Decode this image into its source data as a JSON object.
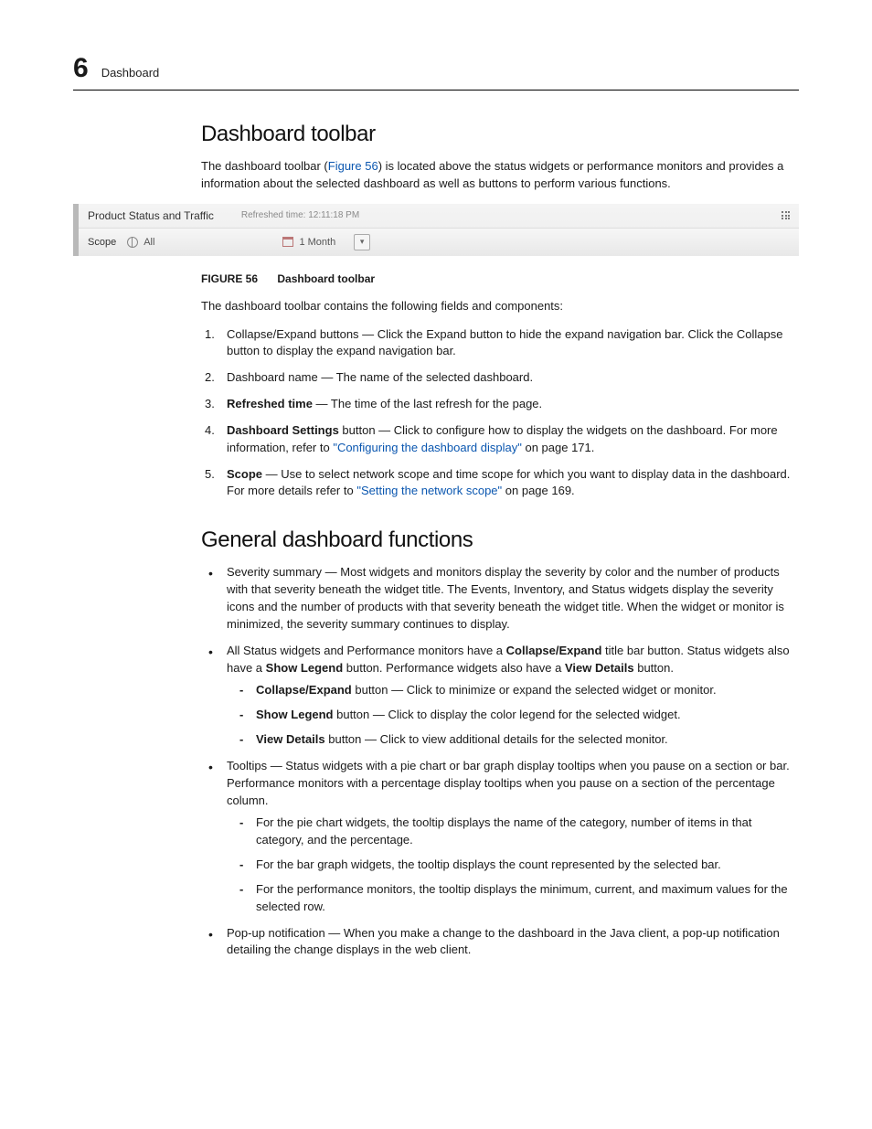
{
  "header": {
    "chapter_number": "6",
    "chapter_title": "Dashboard"
  },
  "section1": {
    "heading": "Dashboard toolbar",
    "intro_a": "The dashboard toolbar (",
    "intro_link": "Figure 56",
    "intro_b": ") is located above the status widgets or performance monitors and provides a information about the selected dashboard as well as buttons to perform various functions."
  },
  "figure": {
    "dashboard_name": "Product Status and Traffic",
    "refreshed_time": "Refreshed time: 12:11:18 PM",
    "scope_label": "Scope",
    "scope_value": "All",
    "time_value": "1 Month",
    "caption_label": "FIGURE 56",
    "caption_title": "Dashboard toolbar"
  },
  "components_intro": "The dashboard toolbar contains the following fields and components:",
  "components": {
    "c1": "Collapse/Expand buttons — Click the Expand button to hide the expand navigation bar. Click the Collapse button to display the expand navigation bar.",
    "c2": "Dashboard name — The name of the selected dashboard.",
    "c3_b": "Refreshed time",
    "c3": " — The time of the last refresh for the page.",
    "c4_b": "Dashboard Settings",
    "c4_a": " button — Click to configure how to display the widgets on the dashboard. For more information, refer to ",
    "c4_link": "\"Configuring the dashboard display\"",
    "c4_c": " on page 171.",
    "c5_b": "Scope",
    "c5_a": " — Use to select network scope and time scope for which you want to display data in the dashboard. For more details refer to ",
    "c5_link": "\"Setting the network scope\"",
    "c5_c": " on page 169."
  },
  "section2": {
    "heading": "General dashboard functions",
    "b1": "Severity summary — Most widgets and monitors display the severity by color and the number of products with that severity beneath the widget title. The Events, Inventory, and Status widgets display the severity icons and the number of products with that severity beneath the widget title. When the widget or monitor is minimized, the severity summary continues to display.",
    "b2_a": "All Status widgets and Performance monitors have a ",
    "b2_b1": "Collapse/Expand",
    "b2_c": " title bar button. Status widgets also have a ",
    "b2_b2": "Show Legend",
    "b2_d": " button. Performance widgets also have a ",
    "b2_b3": "View Details",
    "b2_e": " button.",
    "b2_d1_b": "Collapse/Expand",
    "b2_d1": " button — Click to minimize or expand the selected widget or monitor.",
    "b2_d2_b": "Show Legend",
    "b2_d2": " button — Click to display the color legend for the selected widget.",
    "b2_d3_b": "View Details",
    "b2_d3": " button — Click to view additional details for the selected monitor.",
    "b3": "Tooltips — Status widgets with a pie chart or bar graph display tooltips when you pause on a section or bar. Performance monitors with a percentage display tooltips when you pause on a section of the percentage column.",
    "b3_d1": "For the pie chart widgets, the tooltip displays the name of the category, number of items in that category, and the percentage.",
    "b3_d2": "For the bar graph widgets, the tooltip displays the count represented by the selected bar.",
    "b3_d3": "For the performance monitors, the tooltip displays the minimum, current, and maximum values for the selected row.",
    "b4": "Pop-up notification — When you make a change to the dashboard in the Java client, a pop-up notification detailing the change displays in the web client."
  }
}
